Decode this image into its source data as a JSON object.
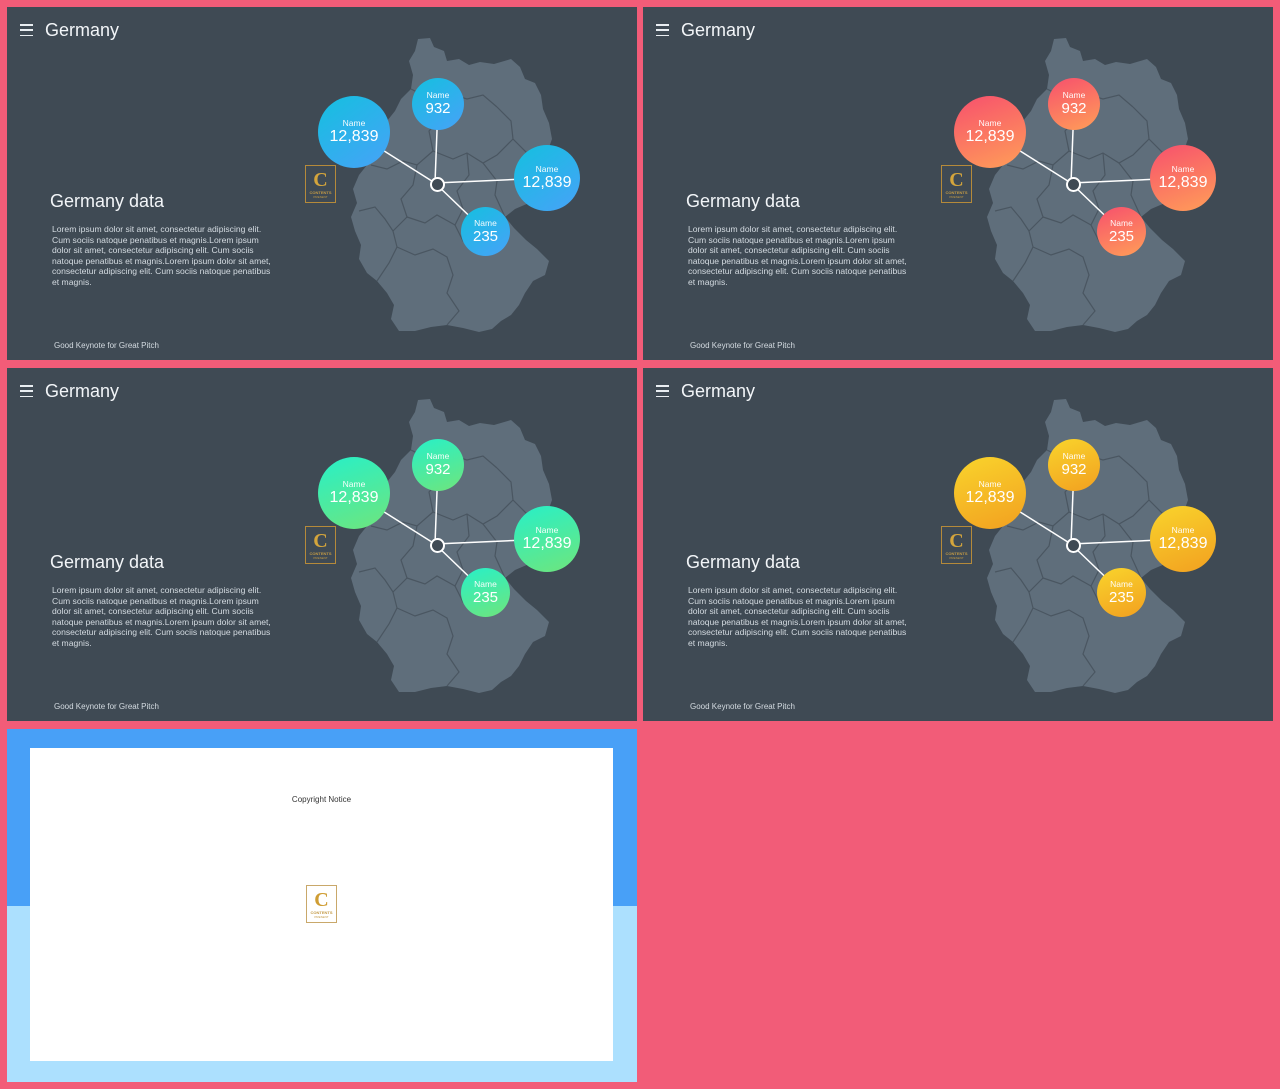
{
  "slides": [
    {
      "title": "Germany",
      "heading": "Germany data",
      "body": "Lorem ipsum dolor sit amet, consectetur adipiscing elit. Cum sociis natoque penatibus et magnis.Lorem ipsum dolor sit amet, consectetur adipiscing elit. Cum sociis natoque penatibus et magnis.Lorem ipsum dolor sit amet, consectetur adipiscing elit. Cum sociis natoque penatibus et magnis.",
      "footer": "Good Keynote for Great Pitch",
      "bubble_color": "#3fa9f5",
      "bubbles": [
        {
          "name": "Name",
          "value": "12,839"
        },
        {
          "name": "Name",
          "value": "932"
        },
        {
          "name": "Name",
          "value": "12,839"
        },
        {
          "name": "Name",
          "value": "235"
        }
      ]
    },
    {
      "title": "Germany",
      "heading": "Germany data",
      "body": "Lorem ipsum dolor sit amet, consectetur adipiscing elit. Cum sociis natoque penatibus et magnis.Lorem ipsum dolor sit amet, consectetur adipiscing elit. Cum sociis natoque penatibus et magnis.Lorem ipsum dolor sit amet, consectetur adipiscing elit. Cum sociis natoque penatibus et magnis.",
      "footer": "Good Keynote for Great Pitch",
      "bubble_color": "#ff7a62",
      "bubbles": [
        {
          "name": "Name",
          "value": "12,839"
        },
        {
          "name": "Name",
          "value": "932"
        },
        {
          "name": "Name",
          "value": "12,839"
        },
        {
          "name": "Name",
          "value": "235"
        }
      ]
    },
    {
      "title": "Germany",
      "heading": "Germany data",
      "body": "Lorem ipsum dolor sit amet, consectetur adipiscing elit. Cum sociis natoque penatibus et magnis.Lorem ipsum dolor sit amet, consectetur adipiscing elit. Cum sociis natoque penatibus et magnis.Lorem ipsum dolor sit amet, consectetur adipiscing elit. Cum sociis natoque penatibus et magnis.",
      "footer": "Good Keynote for Great Pitch",
      "bubble_color": "#3ff0a8",
      "bubbles": [
        {
          "name": "Name",
          "value": "12,839"
        },
        {
          "name": "Name",
          "value": "932"
        },
        {
          "name": "Name",
          "value": "12,839"
        },
        {
          "name": "Name",
          "value": "235"
        }
      ]
    },
    {
      "title": "Germany",
      "heading": "Germany data",
      "body": "Lorem ipsum dolor sit amet, consectetur adipiscing elit. Cum sociis natoque penatibus et magnis.Lorem ipsum dolor sit amet, consectetur adipiscing elit. Cum sociis natoque penatibus et magnis.Lorem ipsum dolor sit amet, consectetur adipiscing elit. Cum sociis natoque penatibus et magnis.",
      "footer": "Good Keynote for Great Pitch",
      "bubble_color": "#f6b822",
      "bubbles": [
        {
          "name": "Name",
          "value": "12,839"
        },
        {
          "name": "Name",
          "value": "932"
        },
        {
          "name": "Name",
          "value": "12,839"
        },
        {
          "name": "Name",
          "value": "235"
        }
      ]
    }
  ],
  "copyright": {
    "notice": "Copyright Notice"
  },
  "logo": {
    "letter": "C",
    "word": "CONTENTS",
    "sub": "PRESENT"
  },
  "colors": {
    "page_background": "#f25c78",
    "slide_background": "#3f4a54",
    "map_fill": "#5f6e7b"
  }
}
